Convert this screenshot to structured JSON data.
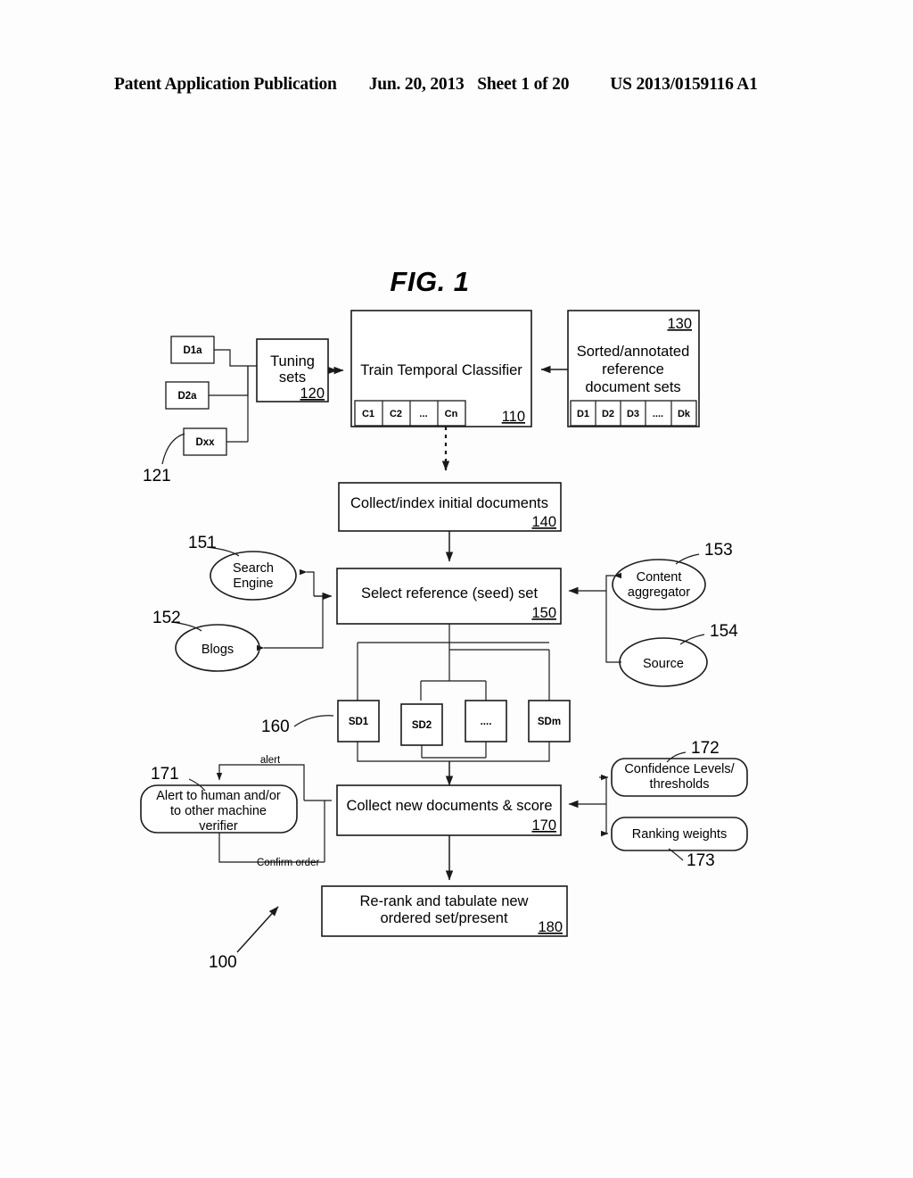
{
  "header": {
    "left": "Patent Application Publication",
    "date": "Jun. 20, 2013",
    "sheet": "Sheet 1 of 20",
    "pub_number": "US 2013/0159116 A1"
  },
  "figure": {
    "title": "FIG. 1",
    "system_ref": "100"
  },
  "tuning_docs": {
    "ref": "121",
    "items": [
      "D1a",
      "D2a",
      "Dxx"
    ]
  },
  "tuning_sets": {
    "line1": "Tuning",
    "line2": "sets",
    "ref": "120"
  },
  "train_classifier": {
    "label": "Train Temporal Classifier",
    "ref": "110",
    "cells": [
      "C1",
      "C2",
      "...",
      "Cn"
    ]
  },
  "reference_sets": {
    "ref": "130",
    "line1": "Sorted/annotated",
    "line2": "reference",
    "line3": "document sets",
    "cells": [
      "D1",
      "D2",
      "D3",
      "....",
      "Dk"
    ]
  },
  "collect_index": {
    "label": "Collect/index initial documents",
    "ref": "140"
  },
  "select_seed": {
    "label": "Select reference (seed) set",
    "ref": "150"
  },
  "sources_left": [
    {
      "ref": "151",
      "line1": "Search",
      "line2": "Engine"
    },
    {
      "ref": "152",
      "line1": "Blogs",
      "line2": ""
    }
  ],
  "sources_right": [
    {
      "ref": "153",
      "line1": "Content",
      "line2": "aggregator"
    },
    {
      "ref": "154",
      "line1": "Source",
      "line2": ""
    }
  ],
  "seed_docs": {
    "ref": "160",
    "items": [
      "SD1",
      "SD2",
      "....",
      "SDm"
    ]
  },
  "alert_verifier": {
    "ref": "171",
    "line1": "Alert to human and/or",
    "line2": "to other machine",
    "line3": "verifier",
    "edge_alert": "alert",
    "edge_confirm": "Confirm order"
  },
  "collect_score": {
    "label": "Collect new documents & score",
    "ref": "170"
  },
  "params_right": [
    {
      "ref": "172",
      "line1": "Confidence Levels/",
      "line2": "thresholds"
    },
    {
      "ref": "173",
      "line1": "Ranking weights",
      "line2": ""
    }
  ],
  "rerank": {
    "line1": "Re-rank and tabulate new",
    "line2": "ordered set/present",
    "ref": "180"
  }
}
